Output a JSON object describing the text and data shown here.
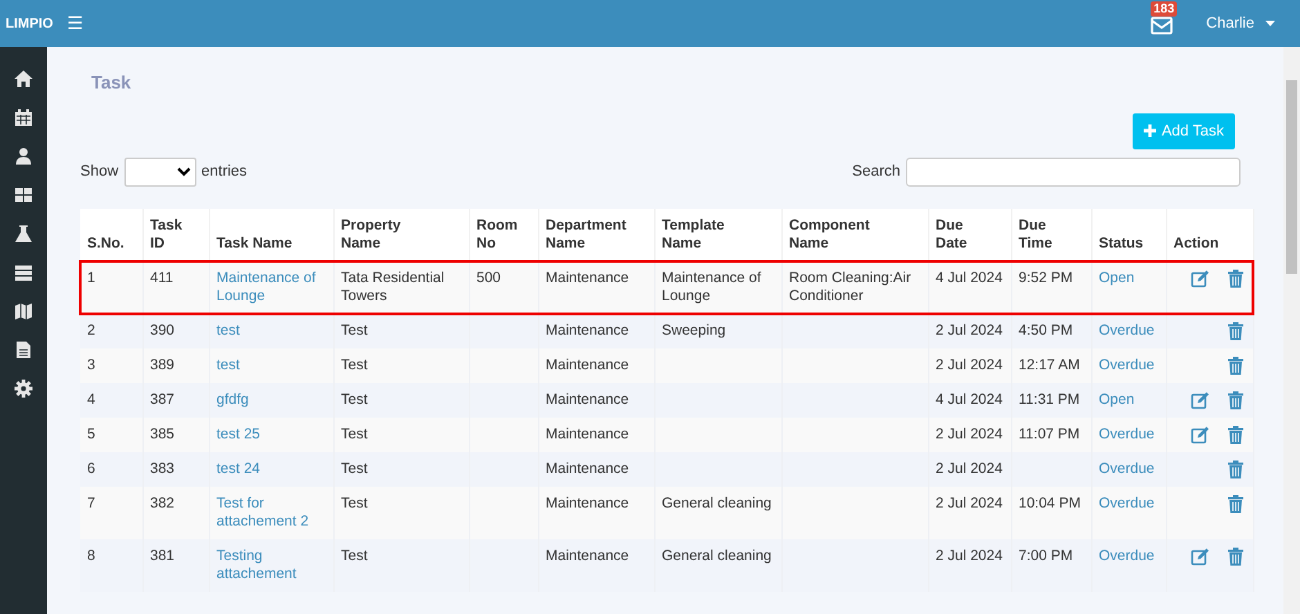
{
  "topbar": {
    "logo": "LIMPIO",
    "menu_icon": "☰",
    "mail_count": "183",
    "user": "Charlie"
  },
  "page": {
    "title": "Task",
    "add_button": "Add Task",
    "show_label": "Show",
    "entries_label": "entries",
    "search_label": "Search"
  },
  "table": {
    "columns": [
      [
        "S.No."
      ],
      [
        "Task",
        "ID"
      ],
      [
        "Task Name"
      ],
      [
        "Property",
        "Name"
      ],
      [
        "Room",
        "No"
      ],
      [
        "Department",
        "Name"
      ],
      [
        "Template",
        "Name"
      ],
      [
        "Component",
        "Name"
      ],
      [
        "Due",
        "Date"
      ],
      [
        "Due",
        "Time"
      ],
      [
        "Status"
      ],
      [
        "Action"
      ]
    ],
    "rows": [
      {
        "sno": "1",
        "id": "411",
        "name": "Maintenance of Lounge",
        "property": "Tata Residential Towers",
        "room": "500",
        "department": "Maintenance",
        "template": "Maintenance of Lounge",
        "component": "Room Cleaning:Air Conditioner",
        "date": "4 Jul 2024",
        "time": "9:52 PM",
        "status": "Open",
        "edit": true,
        "highlighted": true
      },
      {
        "sno": "2",
        "id": "390",
        "name": "test",
        "property": "Test",
        "room": "",
        "department": "Maintenance",
        "template": "Sweeping",
        "component": "",
        "date": "2 Jul 2024",
        "time": "4:50 PM",
        "status": "Overdue",
        "edit": false,
        "highlighted": false
      },
      {
        "sno": "3",
        "id": "389",
        "name": "test",
        "property": "Test",
        "room": "",
        "department": "Maintenance",
        "template": "",
        "component": "",
        "date": "2 Jul 2024",
        "time": "12:17 AM",
        "status": "Overdue",
        "edit": false,
        "highlighted": false
      },
      {
        "sno": "4",
        "id": "387",
        "name": "gfdfg",
        "property": "Test",
        "room": "",
        "department": "Maintenance",
        "template": "",
        "component": "",
        "date": "4 Jul 2024",
        "time": "11:31 PM",
        "status": "Open",
        "edit": true,
        "highlighted": false
      },
      {
        "sno": "5",
        "id": "385",
        "name": "test 25",
        "property": "Test",
        "room": "",
        "department": "Maintenance",
        "template": "",
        "component": "",
        "date": "2 Jul 2024",
        "time": "11:07 PM",
        "status": "Overdue",
        "edit": true,
        "highlighted": false
      },
      {
        "sno": "6",
        "id": "383",
        "name": "test 24",
        "property": "Test",
        "room": "",
        "department": "Maintenance",
        "template": "",
        "component": "",
        "date": "2 Jul 2024",
        "time": "",
        "status": "Overdue",
        "edit": false,
        "highlighted": false
      },
      {
        "sno": "7",
        "id": "382",
        "name": "Test for attachement 2",
        "property": "Test",
        "room": "",
        "department": "Maintenance",
        "template": "General cleaning",
        "component": "",
        "date": "2 Jul 2024",
        "time": "10:04 PM",
        "status": "Overdue",
        "edit": false,
        "highlighted": false
      },
      {
        "sno": "8",
        "id": "381",
        "name": "Testing attachement",
        "property": "Test",
        "room": "",
        "department": "Maintenance",
        "template": "General cleaning",
        "component": "",
        "date": "2 Jul 2024",
        "time": "7:00 PM",
        "status": "Overdue",
        "edit": true,
        "highlighted": false
      }
    ]
  }
}
